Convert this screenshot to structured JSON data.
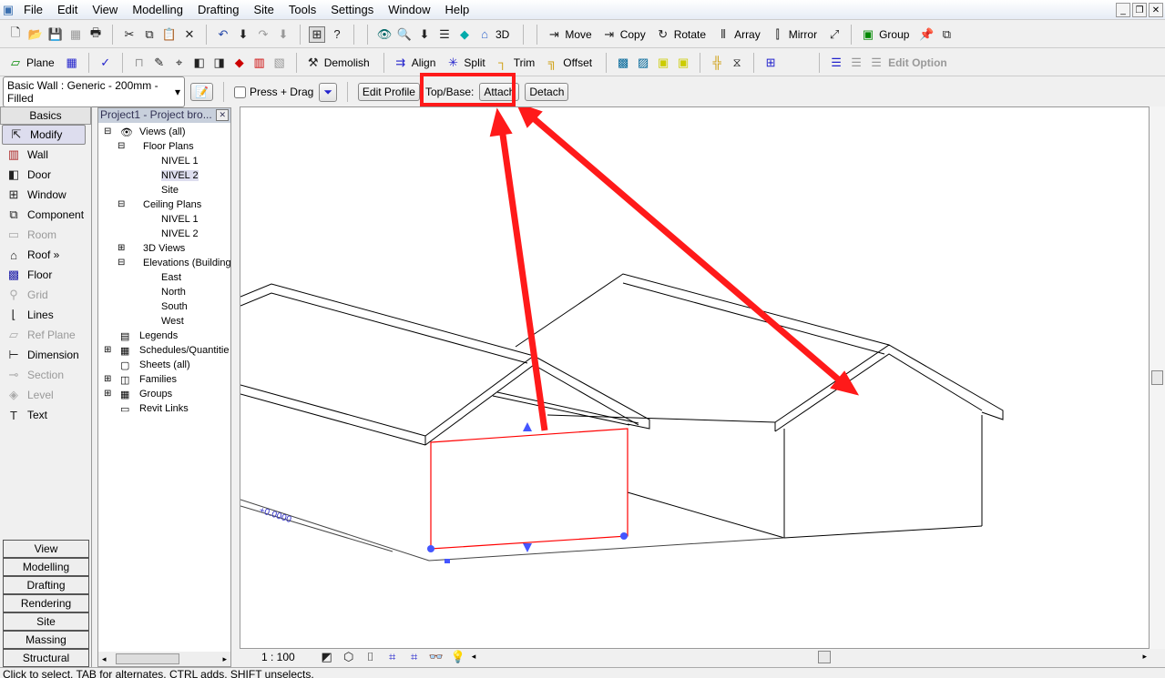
{
  "menu": [
    "File",
    "Edit",
    "View",
    "Modelling",
    "Drafting",
    "Site",
    "Tools",
    "Settings",
    "Window",
    "Help"
  ],
  "toolbar1": {
    "threed": "3D",
    "move": "Move",
    "copy": "Copy",
    "rotate": "Rotate",
    "array": "Array",
    "mirror": "Mirror",
    "group": "Group"
  },
  "toolbar2": {
    "plane": "Plane",
    "demolish": "Demolish",
    "align": "Align",
    "split": "Split",
    "trim": "Trim",
    "offset": "Offset",
    "edit_option": "Edit Option"
  },
  "options": {
    "type_selector": "Basic Wall : Generic - 200mm - Filled",
    "press_drag": "Press + Drag",
    "edit_profile": "Edit Profile",
    "top_base": "Top/Base:",
    "attach": "Attach",
    "detach": "Detach"
  },
  "design_bar": {
    "header": "Basics",
    "items": [
      {
        "label": "Modify",
        "icon": "cursor-icon",
        "enabled": true
      },
      {
        "label": "Wall",
        "icon": "wall-icon",
        "enabled": true
      },
      {
        "label": "Door",
        "icon": "door-icon",
        "enabled": true
      },
      {
        "label": "Window",
        "icon": "window-icon",
        "enabled": true
      },
      {
        "label": "Component",
        "icon": "component-icon",
        "enabled": true
      },
      {
        "label": "Room",
        "icon": "room-icon",
        "enabled": false
      },
      {
        "label": "Roof »",
        "icon": "roof-icon",
        "enabled": true
      },
      {
        "label": "Floor",
        "icon": "floor-icon",
        "enabled": true
      },
      {
        "label": "Grid",
        "icon": "grid-icon",
        "enabled": false
      },
      {
        "label": "Lines",
        "icon": "lines-icon",
        "enabled": true
      },
      {
        "label": "Ref Plane",
        "icon": "ref-plane-icon",
        "enabled": false
      },
      {
        "label": "Dimension",
        "icon": "dimension-icon",
        "enabled": true
      },
      {
        "label": "Section",
        "icon": "section-icon",
        "enabled": false
      },
      {
        "label": "Level",
        "icon": "level-icon",
        "enabled": false
      },
      {
        "label": "Text",
        "icon": "text-icon",
        "enabled": true
      }
    ],
    "tabs": [
      "View",
      "Modelling",
      "Drafting",
      "Rendering",
      "Site",
      "Massing",
      "Structural"
    ]
  },
  "browser": {
    "title": "Project1 - Project bro...",
    "tree": [
      "Views (all)",
      "Floor Plans",
      "NIVEL 1",
      "NIVEL 2",
      "Site",
      "Ceiling Plans",
      "NIVEL 1",
      "NIVEL 2",
      "3D Views",
      "Elevations (Building",
      "East",
      "North",
      "South",
      "West",
      "Legends",
      "Schedules/Quantitie",
      "Sheets (all)",
      "Families",
      "Groups",
      "Revit Links"
    ]
  },
  "view": {
    "scale": "1 : 100",
    "dim_label": "+0.0000",
    "colors": {
      "selection": "#ff0000",
      "arrow": "#ff1a1a"
    }
  },
  "status": "Click to select, TAB for alternates, CTRL adds, SHIFT unselects."
}
